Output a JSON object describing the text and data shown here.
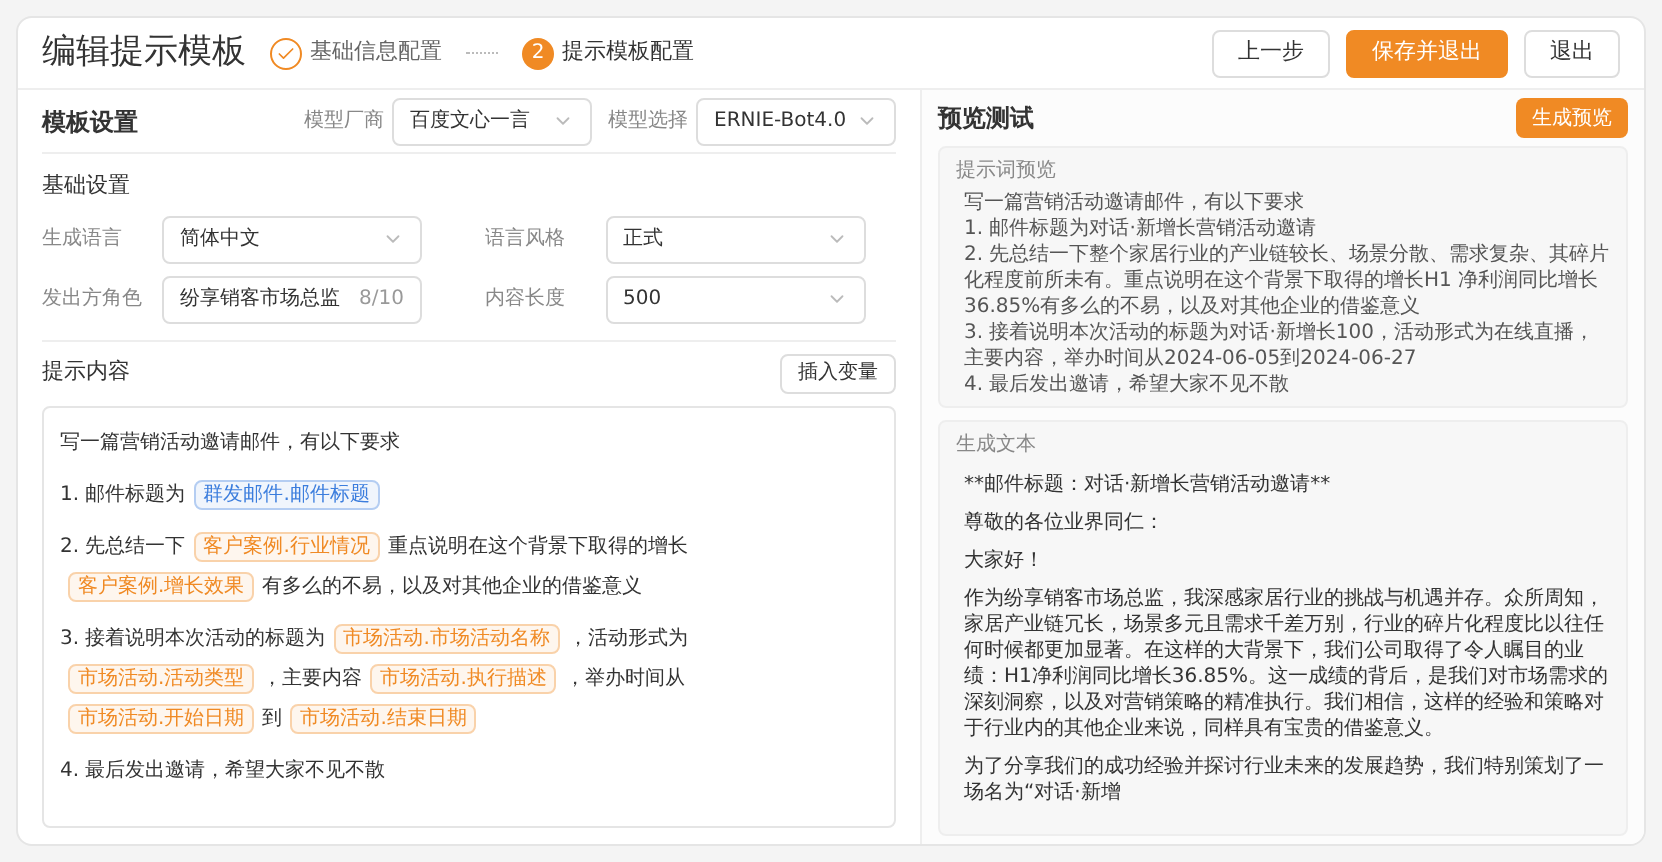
{
  "title": "编辑提示模板",
  "steps": [
    {
      "label": "基础信息配置",
      "kind": "done"
    },
    {
      "label": "提示模板配置",
      "kind": "current",
      "number": "2"
    }
  ],
  "header_buttons": [
    {
      "label": "上一步",
      "kind": "default"
    },
    {
      "label": "保存并退出",
      "kind": "primary"
    },
    {
      "label": "退出",
      "kind": "default"
    }
  ],
  "template_settings": {
    "title": "模板设置",
    "model_fields": [
      {
        "label": "模型厂商",
        "value": "百度文心一言"
      },
      {
        "label": "模型选择",
        "value": "ERNIE-Bot4.0"
      }
    ],
    "basic_title": "基础设置",
    "fields": [
      {
        "label": "生成语言",
        "value": "简体中文",
        "kind": "select"
      },
      {
        "label": "语言风格",
        "value": "正式",
        "kind": "select"
      },
      {
        "label": "发出方角色",
        "value": "纷享销客市场总监",
        "counter": "8/10",
        "kind": "input"
      },
      {
        "label": "内容长度",
        "value": "500",
        "kind": "select"
      }
    ]
  },
  "prompt": {
    "title": "提示内容",
    "button": "插入变量",
    "lines": [
      {
        "segments": [
          {
            "kind": "text",
            "text": "写一篇营销活动邀请邮件，有以下要求"
          }
        ]
      },
      {
        "segments": [
          {
            "kind": "text",
            "text": "1. 邮件标题为"
          },
          {
            "kind": "variable",
            "text": "群发邮件.邮件标题",
            "color": "#3b7ddd"
          }
        ]
      },
      {
        "segments": [
          {
            "kind": "text",
            "text": "2. 先总结一下"
          },
          {
            "kind": "variable",
            "text": "客户案例.行业情况",
            "color": "#f08a24"
          },
          {
            "kind": "text",
            "text": "重点说明在这个背景下取得的增长"
          },
          {
            "kind": "variable",
            "text": "客户案例.增长效果",
            "color": "#f08a24"
          },
          {
            "kind": "text",
            "text": "有多么的不易，以及对其他企业的借鉴意义"
          }
        ]
      },
      {
        "segments": [
          {
            "kind": "text",
            "text": "3. 接着说明本次活动的标题为"
          },
          {
            "kind": "variable",
            "text": "市场活动.市场活动名称",
            "color": "#f08a24"
          },
          {
            "kind": "text",
            "text": "，活动形式为"
          },
          {
            "kind": "variable",
            "text": "市场活动.活动类型",
            "color": "#f08a24"
          },
          {
            "kind": "text",
            "text": "，主要内容"
          },
          {
            "kind": "variable",
            "text": "市场活动.执行描述",
            "color": "#f08a24"
          },
          {
            "kind": "text",
            "text": "，举办时间从"
          },
          {
            "kind": "variable",
            "text": "市场活动.开始日期",
            "color": "#f08a24"
          },
          {
            "kind": "text",
            "text": "到"
          },
          {
            "kind": "variable",
            "text": "市场活动.结束日期",
            "color": "#f08a24"
          }
        ]
      },
      {
        "segments": [
          {
            "kind": "text",
            "text": "4. 最后发出邀请，希望大家不见不散"
          }
        ]
      }
    ]
  },
  "preview": {
    "title": "预览测试",
    "button": "生成预览",
    "prompt_label": "提示词预览",
    "prompt_lines": [
      "写一篇营销活动邀请邮件，有以下要求",
      "1. 邮件标题为对话·新增长营销活动邀请",
      "2. 先总结一下整个家居行业的产业链较长、场景分散、需求复杂、其碎片化程度前所未有。重点说明在这个背景下取得的增长H1 净利润同比增长 36.85%有多么的不易，以及对其他企业的借鉴意义",
      "3. 接着说明本次活动的标题为对话·新增长100，活动形式为在线直播，主要内容，举办时间从2024-06-05到2024-06-27",
      "4. 最后发出邀请，希望大家不见不散"
    ],
    "output_label": "生成文本",
    "output_paragraphs": [
      "**邮件标题：对话·新增长营销活动邀请**",
      "尊敬的各位业界同仁：",
      "大家好！",
      "作为纷享销客市场总监，我深感家居行业的挑战与机遇并存。众所周知，家居产业链冗长，场景多元且需求千差万别，行业的碎片化程度比以往任何时候都更加显著。在这样的大背景下，我们公司取得了令人瞩目的业绩：H1净利润同比增长36.85%。这一成绩的背后，是我们对市场需求的深刻洞察，以及对营销策略的精准执行。我们相信，这样的经验和策略对于行业内的其他企业来说，同样具有宝贵的借鉴意义。",
      "为了分享我们的成功经验并探讨行业未来的发展趋势，我们特别策划了一场名为“对话·新增"
    ]
  }
}
